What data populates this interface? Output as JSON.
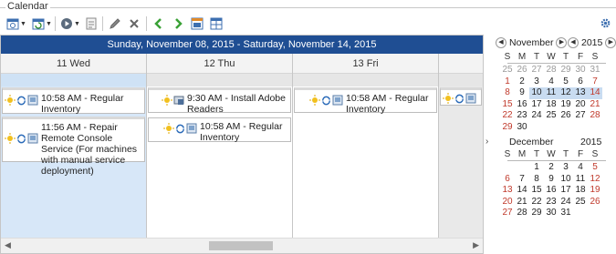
{
  "group_title": "Calendar",
  "week_range": "Sunday, November 08, 2015 - Saturday, November 14, 2015",
  "days": [
    {
      "label": "11 Wed"
    },
    {
      "label": "12 Thu"
    },
    {
      "label": "13 Fri"
    }
  ],
  "appointments": {
    "wed_1": "10:58 AM - Regular Inventory",
    "wed_2": "11:56 AM - Repair Remote Console Service (For machines with manual service deployment)",
    "thu_1": "9:30 AM - Install Adobe Readers",
    "thu_2": "10:58 AM - Regular Inventory",
    "fri_1": "10:58 AM - Regular Inventory"
  },
  "mini_calendar": {
    "month1": {
      "month": "November",
      "year": "2015",
      "weekdays": [
        "S",
        "M",
        "T",
        "W",
        "T",
        "F",
        "S"
      ],
      "days": [
        [
          "25",
          "26",
          "27",
          "28",
          "29",
          "30",
          "31"
        ],
        [
          "1",
          "2",
          "3",
          "4",
          "5",
          "6",
          "7"
        ],
        [
          "8",
          "9",
          "10",
          "11",
          "12",
          "13",
          "14"
        ],
        [
          "15",
          "16",
          "17",
          "18",
          "19",
          "20",
          "21"
        ],
        [
          "22",
          "23",
          "24",
          "25",
          "26",
          "27",
          "28"
        ],
        [
          "29",
          "30",
          "",
          "",
          "",
          "",
          ""
        ]
      ]
    },
    "month2": {
      "month": "December",
      "year": "2015",
      "weekdays": [
        "S",
        "M",
        "T",
        "W",
        "T",
        "F",
        "S"
      ],
      "days": [
        [
          "",
          "",
          "1",
          "2",
          "3",
          "4",
          "5"
        ],
        [
          "6",
          "7",
          "8",
          "9",
          "10",
          "11",
          "12"
        ],
        [
          "13",
          "14",
          "15",
          "16",
          "17",
          "18",
          "19"
        ],
        [
          "20",
          "21",
          "22",
          "23",
          "24",
          "25",
          "26"
        ],
        [
          "27",
          "28",
          "29",
          "30",
          "31",
          "",
          ""
        ]
      ]
    }
  },
  "colors": {
    "header_bg": "#1f4e93",
    "selected_day": "#d7e7f8",
    "weekend_red": "#c0392b"
  },
  "icons": [
    "calendar-icon",
    "refresh-calendar-icon",
    "play-icon",
    "properties-icon",
    "edit-icon",
    "delete-icon",
    "back-arrow-icon",
    "forward-arrow-icon",
    "day-view-icon",
    "week-view-icon",
    "gear-icon"
  ]
}
